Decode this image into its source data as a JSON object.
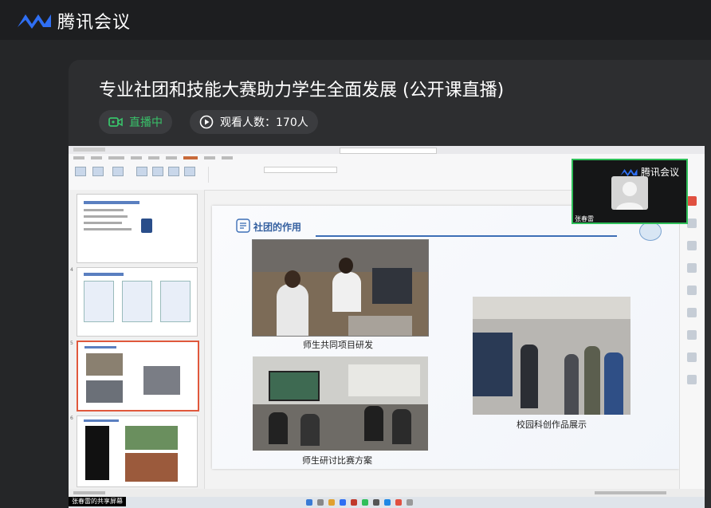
{
  "app": {
    "name": "腾讯会议"
  },
  "meeting": {
    "title": "专业社团和技能大赛助力学生全面发展 (公开课直播)",
    "live_status": "直播中",
    "viewers_label": "观看人数：170人"
  },
  "shared_screen": {
    "slide": {
      "title": "社团的作用",
      "captions": [
        "师生共同项目研发",
        "校园科创作品展示",
        "师生研讨比赛方案"
      ]
    },
    "thumbnail_numbers": [
      "4",
      "5",
      "6"
    ],
    "sharer_label": "张春雷的共享屏幕"
  },
  "video_tile": {
    "logo_text": "腾讯会议",
    "participant_name": "张春雷"
  },
  "colors": {
    "live_green": "#39c26a",
    "brand_blue": "#2f6ff3",
    "video_border": "#2fbf5a"
  }
}
